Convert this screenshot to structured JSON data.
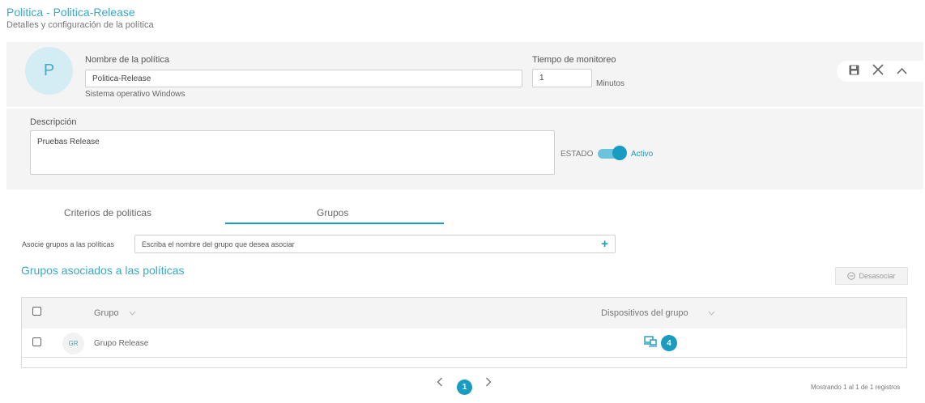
{
  "header": {
    "title": "Politica - Politica-Release",
    "subtitle": "Detalles y configuración de la política"
  },
  "policy": {
    "avatar_letter": "P",
    "name_label": "Nombre de la política",
    "name_value": "Politica-Release",
    "os_text": "Sistema operativo Windows",
    "monitor_label": "Tiempo de monitoreo",
    "monitor_value": "1",
    "monitor_unit": "Minutos",
    "description_label": "Descripción",
    "description_value": "Pruebas Release",
    "state_label": "ESTADO",
    "state_value": "Activo",
    "state_on": true
  },
  "toolbar": {
    "save_icon": "save-icon",
    "close_icon": "close-icon",
    "collapse_icon": "chevron-up-icon"
  },
  "tabs": [
    {
      "label": "Criterios de politicas",
      "active": false
    },
    {
      "label": "Grupos",
      "active": true
    }
  ],
  "associate": {
    "label": "Asocie grupos a las políticas",
    "placeholder": "Escriba el nombre del grupo que desea asociar"
  },
  "groups_section": {
    "title": "Grupos asociados a las políticas",
    "disassociate_label": "Desasociar"
  },
  "table": {
    "columns": [
      "Grupo",
      "Dispositivos del grupo"
    ],
    "rows": [
      {
        "initials": "GR",
        "name": "Grupo Release",
        "devices": "4"
      }
    ]
  },
  "pagination": {
    "current_page": "1",
    "summary": "Mostrando 1 al 1 de 1 registros"
  },
  "colors": {
    "accent": "#1a9bc2",
    "title": "#3aa8c6",
    "panel_bg": "#f4f4f4"
  }
}
